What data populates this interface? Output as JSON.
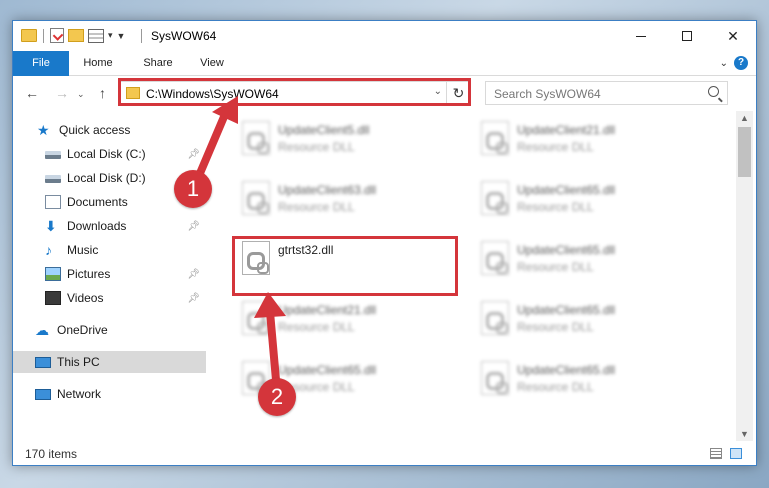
{
  "window": {
    "title": "SysWOW64",
    "controls": {
      "minimize": "minimize",
      "maximize": "maximize",
      "close": "✕"
    }
  },
  "ribbon": {
    "tabs": [
      {
        "label": "File"
      },
      {
        "label": "Home"
      },
      {
        "label": "Share"
      },
      {
        "label": "View"
      }
    ],
    "help": "?"
  },
  "navbar": {
    "back": "←",
    "forward": "→",
    "recent": "⌄",
    "up": "↑",
    "address": "C:\\Windows\\SysWOW64",
    "refresh": "↻",
    "search_placeholder": "Search SysWOW64"
  },
  "sidebar": {
    "items": [
      {
        "label": "Quick access",
        "icon": "star-icon"
      },
      {
        "label": "Local Disk (C:)",
        "icon": "disk-icon",
        "pinned": true
      },
      {
        "label": "Local Disk (D:)",
        "icon": "disk-icon",
        "pinned": false
      },
      {
        "label": "Documents",
        "icon": "documents-icon",
        "pinned": true
      },
      {
        "label": "Downloads",
        "icon": "download-icon",
        "pinned": true
      },
      {
        "label": "Music",
        "icon": "music-icon",
        "pinned": false
      },
      {
        "label": "Pictures",
        "icon": "pictures-icon",
        "pinned": true
      },
      {
        "label": "Videos",
        "icon": "videos-icon",
        "pinned": true
      },
      {
        "label": "OneDrive",
        "icon": "cloud-icon"
      },
      {
        "label": "This PC",
        "icon": "computer-icon",
        "selected": true
      },
      {
        "label": "Network",
        "icon": "network-icon"
      }
    ]
  },
  "files": [
    {
      "name": "UpdateClient5.dll",
      "type": "Resource DLL",
      "blurred": true
    },
    {
      "name": "UpdateClient21.dll",
      "type": "Resource DLL",
      "blurred": true
    },
    {
      "name": "UpdateClient63.dll",
      "type": "Resource DLL",
      "blurred": true
    },
    {
      "name": "UpdateClient65.dll",
      "type": "Resource DLL",
      "blurred": true
    },
    {
      "name": "gtrtst32.dll",
      "type": "",
      "blurred": false
    },
    {
      "name": "UpdateClient65.dll",
      "type": "Resource DLL",
      "blurred": true
    },
    {
      "name": "UpdateClient21.dll",
      "type": "Resource DLL",
      "blurred": true
    },
    {
      "name": "UpdateClient65.dll",
      "type": "Resource DLL",
      "blurred": true
    },
    {
      "name": "UpdateClient65.dll",
      "type": "Resource DLL",
      "blurred": true
    },
    {
      "name": "UpdateClient65.dll",
      "type": "Resource DLL",
      "blurred": true
    }
  ],
  "status": {
    "item_count": "170 items"
  },
  "annotations": {
    "badge1": "1",
    "badge2": "2",
    "highlight_color": "#d4353b"
  }
}
